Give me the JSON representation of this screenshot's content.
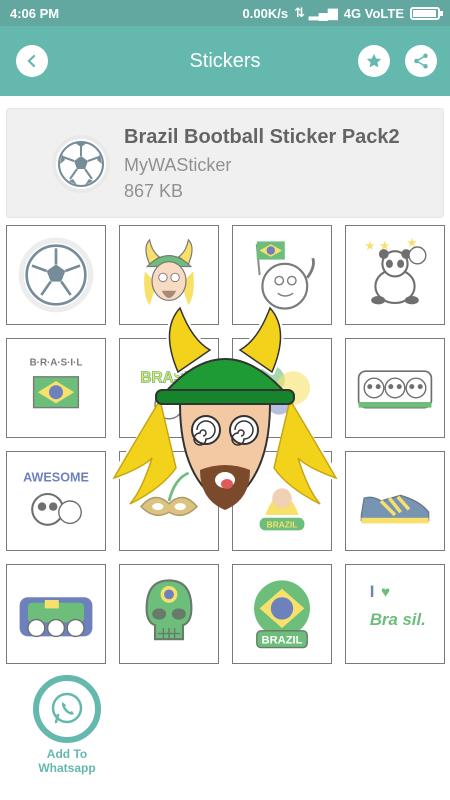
{
  "status": {
    "time": "4:06 PM",
    "net_speed": "0.00K/s",
    "network": "4G VoLTE",
    "battery_level": 0.95
  },
  "app_bar": {
    "title": "Stickers",
    "back_icon": "back-arrow-icon",
    "star_icon": "star-icon",
    "share_icon": "share-icon"
  },
  "pack": {
    "title": "Brazil Bootball Sticker Pack2",
    "author": "MyWASticker",
    "size": "867 KB",
    "icon": "soccer-ball-icon"
  },
  "stickers": [
    {
      "name": "soccer-ball",
      "text": ""
    },
    {
      "name": "viking-fan",
      "text": ""
    },
    {
      "name": "ball-with-flag",
      "text": ""
    },
    {
      "name": "panda-stars",
      "text": ""
    },
    {
      "name": "brasil-banner",
      "text": "B·R·A·S·I·L"
    },
    {
      "name": "brasil-text",
      "text": "BRASIL"
    },
    {
      "name": "paint-splash",
      "text": ""
    },
    {
      "name": "panda-trio",
      "text": ""
    },
    {
      "name": "awesome-panda",
      "text": "AWESOME"
    },
    {
      "name": "carnival-mask",
      "text": ""
    },
    {
      "name": "brazil-girl",
      "text": "BRAZIL"
    },
    {
      "name": "sneaker",
      "text": ""
    },
    {
      "name": "panda-bus",
      "text": ""
    },
    {
      "name": "skull-flag",
      "text": ""
    },
    {
      "name": "brazil-badge",
      "text": "BRAZIL"
    },
    {
      "name": "i-love-brasil",
      "text": "Bra sil."
    }
  ],
  "add_button": {
    "label": "Add To Whatsapp",
    "icon": "whatsapp-icon"
  },
  "preview": {
    "name": "viking-fan-preview"
  },
  "colors": {
    "primary": "#129282",
    "status_bar": "#0e7a6d",
    "brazil_green": "#1f9b35",
    "brazil_yellow": "#f3d21c",
    "brazil_blue": "#1f3f9a"
  }
}
